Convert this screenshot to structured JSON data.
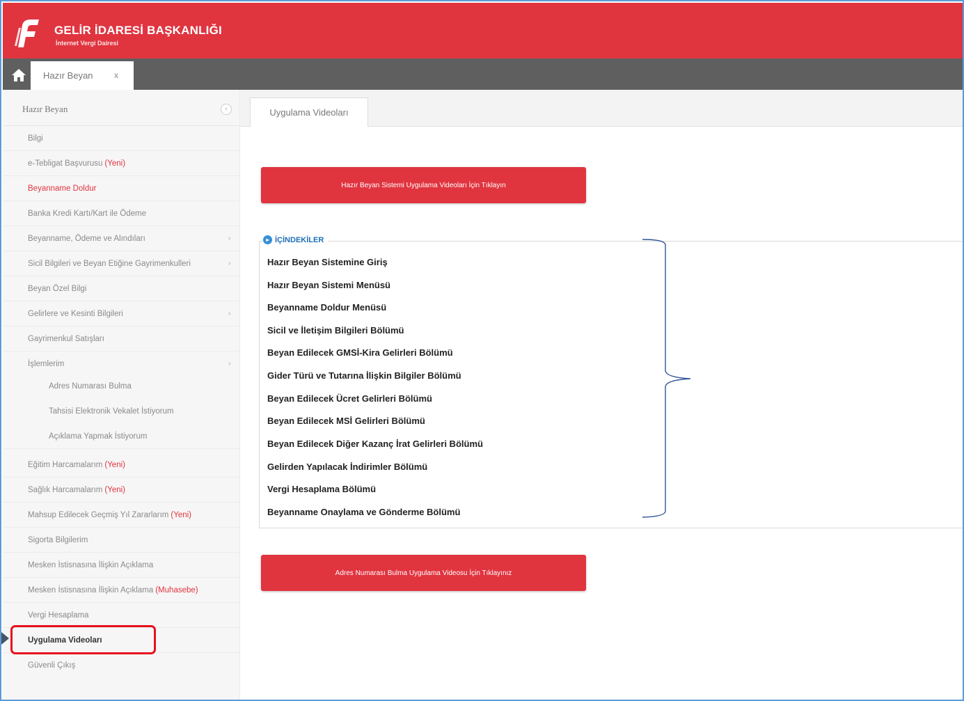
{
  "header": {
    "title": "GELİR İDARESİ BAŞKANLIĞI",
    "subtitle": "İnternet Vergi Dairesi"
  },
  "tabbar": {
    "tab_label": "Hazır Beyan",
    "tab_close": "x"
  },
  "sidebar": {
    "heading": "Hazır Beyan",
    "collapse_symbol": "‹",
    "items": [
      {
        "label": "Bilgi",
        "new": "",
        "chevron": ""
      },
      {
        "label": "e-Tebligat Başvurusu",
        "new": "(Yeni)",
        "chevron": ""
      },
      {
        "label": "Beyanname Doldur",
        "new": "",
        "chevron": ""
      },
      {
        "label": "Banka Kredi Kartı/Kart ile Ödeme",
        "new": "",
        "chevron": ""
      },
      {
        "label": "Beyanname, Ödeme ve Alındıları",
        "new": "",
        "chevron": "›"
      },
      {
        "label": "Sicil Bilgileri ve Beyan Etiğine Gayrimenkulleri",
        "new": "",
        "chevron": "›"
      },
      {
        "label": "Beyan Özel Bilgi",
        "new": "",
        "chevron": ""
      },
      {
        "label": "Gelirlere ve Kesinti Bilgileri",
        "new": "",
        "chevron": "›"
      },
      {
        "label": "Gayrimenkul Satışları",
        "new": "",
        "chevron": ""
      },
      {
        "label": "İşlemlerim",
        "new": "",
        "chevron": "›"
      }
    ],
    "subitems": [
      {
        "label": "Adres Numarası Bulma"
      },
      {
        "label": "Tahsisi Elektronik Vekalet İstiyorum"
      },
      {
        "label": "Açıklama Yapmak İstiyorum"
      }
    ],
    "items2": [
      {
        "label": "Eğitim Harcamalarım",
        "new": "(Yeni)"
      },
      {
        "label": "Sağlık Harcamalarım",
        "new": "(Yeni)"
      },
      {
        "label": "Mahsup Edilecek Geçmiş Yıl Zararlarım",
        "new": "(Yeni)"
      },
      {
        "label": "Sigorta Bilgilerim",
        "new": ""
      },
      {
        "label": "Mesken İstisnasına İlişkin Açıklama",
        "new": ""
      },
      {
        "label": "Mesken İstisnasına İlişkin Açıklama",
        "new": "(Muhasebe)"
      },
      {
        "label": "Vergi Hesaplama",
        "new": ""
      },
      {
        "label": "Uygulama Videoları",
        "new": ""
      },
      {
        "label": "Güvenli Çıkış",
        "new": ""
      }
    ]
  },
  "main": {
    "tab_label": "Uygulama Videoları",
    "button_top": "Hazır Beyan Sistemi Uygulama Videoları İçin Tıklayın",
    "button_bottom": "Adres Numarası Bulma Uygulama Videosu İçin Tıklayınız",
    "toc": {
      "legend": "İÇİNDEKİLER",
      "items": [
        "Hazır Beyan Sistemine Giriş",
        "Hazır Beyan Sistemi Menüsü",
        "Beyanname Doldur Menüsü",
        "Sicil ve İletişim Bilgileri Bölümü",
        "Beyan Edilecek GMSİ-Kira Gelirleri Bölümü",
        "Gider Türü ve Tutarına İlişkin Bilgiler Bölümü",
        "Beyan Edilecek Ücret Gelirleri Bölümü",
        "Beyan Edilecek MSİ Gelirleri Bölümü",
        "Beyan Edilecek Diğer Kazanç İrat Gelirleri Bölümü",
        "Gelirden Yapılacak İndirimler Bölümü",
        "Vergi Hesaplama Bölümü",
        "Beyanname Onaylama ve Gönderme Bölümü"
      ]
    }
  },
  "colors": {
    "brand_red": "#e0343f",
    "tabbar_gray": "#5f5f5f",
    "highlight_red": "#e8101d",
    "annotation_blue": "#2f5597"
  }
}
